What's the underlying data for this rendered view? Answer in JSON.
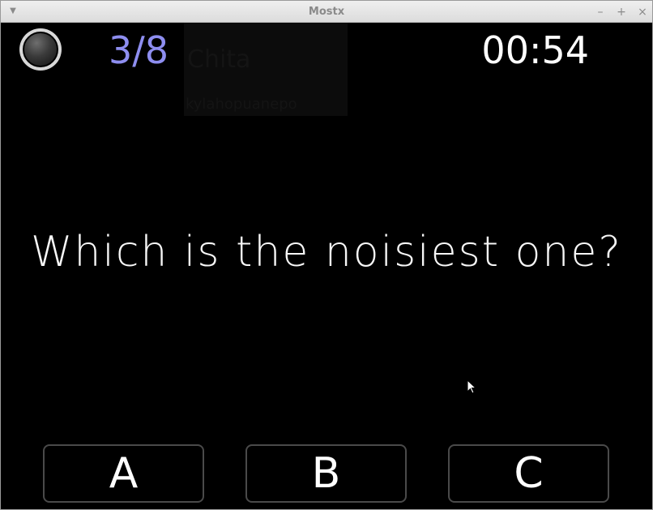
{
  "window": {
    "title": "Mostx",
    "menu_icon": "chevron-down-icon",
    "controls": [
      {
        "name": "minimize",
        "glyph": "–"
      },
      {
        "name": "maximize",
        "glyph": "+"
      },
      {
        "name": "close",
        "glyph": "×"
      }
    ]
  },
  "hud": {
    "status_light": "indicator-off",
    "progress": "3/8",
    "timer": "00:54"
  },
  "background_ghost": {
    "line1": "Chita",
    "line2": "kylahopuanepo"
  },
  "question": {
    "text": "Which is the noisiest one?"
  },
  "answers": [
    {
      "label": "A"
    },
    {
      "label": "B"
    },
    {
      "label": "C"
    }
  ],
  "colors": {
    "background": "#000000",
    "progress": "#8e8ef0",
    "text": "#ffffff",
    "button_border": "#4a4a4a"
  }
}
